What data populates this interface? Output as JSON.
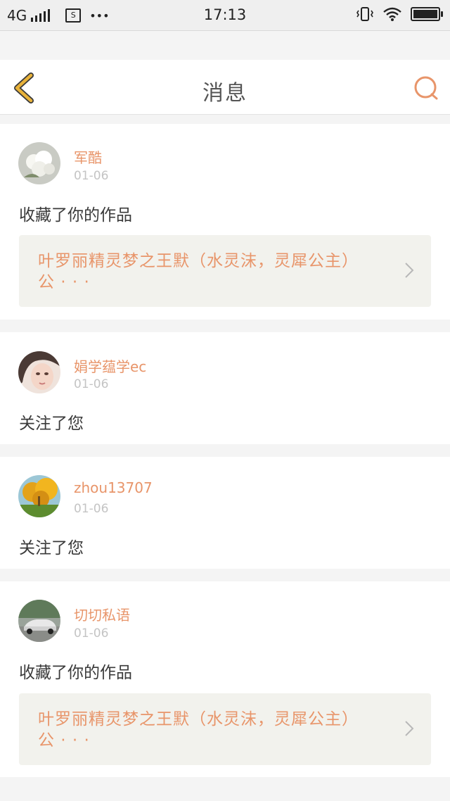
{
  "status_bar": {
    "network": "4G",
    "time": "17:13",
    "more": "•••",
    "sim_label": "S"
  },
  "header": {
    "title": "消息",
    "back_icon": "chevron-left-icon",
    "search_icon": "search-icon"
  },
  "colors": {
    "accent": "#e8956a",
    "back_icon": "#e8b23a",
    "background": "#f4f4f4",
    "work_bg": "#f2f2ed"
  },
  "messages": [
    {
      "user": "军酷",
      "date": "01-06",
      "action": "收藏了你的作品",
      "work_title": "叶罗丽精灵梦之王默（水灵沫，灵犀公主）公 · · ·"
    },
    {
      "user": "娟学蕴学ec",
      "date": "01-06",
      "action": "关注了您"
    },
    {
      "user": "zhou13707",
      "date": "01-06",
      "action": "关注了您"
    },
    {
      "user": "切切私语",
      "date": "01-06",
      "action": "收藏了你的作品",
      "work_title": "叶罗丽精灵梦之王默（水灵沫，灵犀公主）公 · · ·"
    }
  ]
}
